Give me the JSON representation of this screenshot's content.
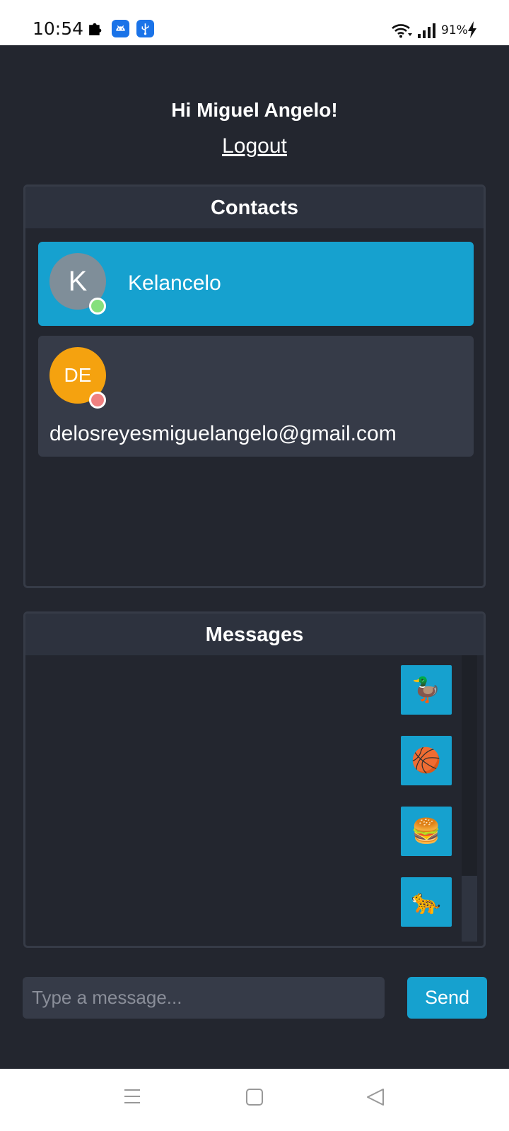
{
  "status_bar": {
    "time": "10:54",
    "battery": "91%",
    "icons": [
      "puzzle-icon",
      "android-icon",
      "usb-icon",
      "wifi-icon",
      "signal-icon",
      "charging-bolt-icon"
    ]
  },
  "header": {
    "greeting": "Hi Miguel Angelo!",
    "logout_label": "Logout"
  },
  "contacts": {
    "title": "Contacts",
    "items": [
      {
        "initials": "K",
        "name": "Kelancelo",
        "status": "online",
        "selected": true,
        "avatar_color": "#7f8e99",
        "status_color": "#86e07d"
      },
      {
        "initials": "DE",
        "name": "delosreyesmiguelangelo@gmail.com",
        "status": "offline",
        "selected": false,
        "avatar_color": "#f5a20f",
        "status_color": "#f08080"
      }
    ]
  },
  "messages": {
    "title": "Messages",
    "items": [
      "🦆",
      "🏀",
      "🍔",
      "🐆"
    ]
  },
  "composer": {
    "placeholder": "Type a message...",
    "value": "",
    "send_label": "Send"
  },
  "colors": {
    "background": "#23262f",
    "panel_header": "#2d323e",
    "accent": "#16a1cf",
    "card": "#363b48"
  },
  "nav_bar": {
    "buttons": [
      "menu-icon",
      "home-icon",
      "back-icon"
    ]
  }
}
